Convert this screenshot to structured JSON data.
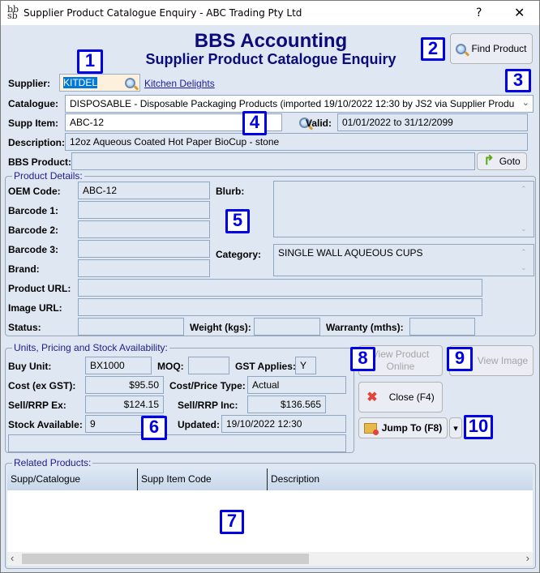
{
  "window": {
    "title": "Supplier Product Catalogue Enquiry - ABC Trading Pty Ltd",
    "help_label": "?",
    "close_label": "✕",
    "app_icon_label": "bb\nsb"
  },
  "header": {
    "title": "BBS Accounting",
    "subtitle": "Supplier Product Catalogue Enquiry"
  },
  "buttons": {
    "find_product": "Find Product",
    "goto": "Goto",
    "view_product_online_line1": "View Product",
    "view_product_online_line2": "Online",
    "view_image": "View Image",
    "close": "Close (F4)",
    "jump_to": "Jump To (F8)",
    "dropdown_arrow": "▾"
  },
  "supplier": {
    "label": "Supplier:",
    "code": "KITDEL",
    "name": "Kitchen Delights"
  },
  "catalogue": {
    "label": "Catalogue:",
    "value": "DISPOSABLE - Disposable Packaging Products (imported 19/10/2022 12:30 by JS2 via Supplier Produ"
  },
  "supp_item": {
    "label": "Supp Item:",
    "value": "ABC-12"
  },
  "valid": {
    "label": "Valid:",
    "value": "01/01/2022 to 31/12/2099"
  },
  "description": {
    "label": "Description:",
    "value": "12oz Aqueous Coated Hot Paper BioCup - stone"
  },
  "bbs_product": {
    "label": "BBS Product:",
    "value": ""
  },
  "product_details": {
    "legend": "Product Details:",
    "oem_code_label": "OEM Code:",
    "oem_code": "ABC-12",
    "barcode1_label": "Barcode 1:",
    "barcode1": "",
    "barcode2_label": "Barcode 2:",
    "barcode2": "",
    "barcode3_label": "Barcode 3:",
    "barcode3": "",
    "brand_label": "Brand:",
    "brand": "",
    "blurb_label": "Blurb:",
    "blurb": "",
    "category_label": "Category:",
    "category": "SINGLE WALL AQUEOUS CUPS",
    "product_url_label": "Product URL:",
    "product_url": "",
    "image_url_label": "Image URL:",
    "image_url": "",
    "status_label": "Status:",
    "status": "",
    "weight_label": "Weight (kgs):",
    "weight": "",
    "warranty_label": "Warranty (mths):",
    "warranty": ""
  },
  "pricing": {
    "legend": "Units, Pricing and Stock Availability:",
    "buy_unit_label": "Buy Unit:",
    "buy_unit": "BX1000",
    "moq_label": "MOQ:",
    "moq": "",
    "gst_label": "GST Applies:",
    "gst": "Y",
    "cost_label": "Cost (ex GST):",
    "cost": "$95.50",
    "cost_type_label": "Cost/Price Type:",
    "cost_type": "Actual",
    "sell_ex_label": "Sell/RRP Ex:",
    "sell_ex": "$124.15",
    "sell_inc_label": "Sell/RRP Inc:",
    "sell_inc": "$136.565",
    "stock_label": "Stock Available:",
    "stock": "9",
    "updated_label": "Updated:",
    "updated": "19/10/2022 12:30",
    "note": ""
  },
  "related": {
    "legend": "Related Products:",
    "columns": [
      "Supp/Catalogue",
      "Supp Item Code",
      "Description"
    ],
    "rows": []
  },
  "scrollbar": {
    "left": "‹",
    "right": "›"
  },
  "badges": [
    "1",
    "2",
    "3",
    "4",
    "5",
    "6",
    "7",
    "8",
    "9",
    "10"
  ],
  "colors": {
    "heading": "#0b0b7a",
    "badge": "#0000e6",
    "selection": "#0078d7",
    "link": "#1d1d9b"
  }
}
